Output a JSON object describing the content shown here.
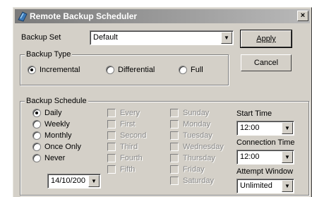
{
  "window": {
    "title": "Remote Backup Scheduler",
    "close_label": "×"
  },
  "backup_set": {
    "label": "Backup Set",
    "value": "Default"
  },
  "buttons": {
    "apply": "Apply",
    "cancel": "Cancel"
  },
  "backup_type": {
    "legend": "Backup Type",
    "options": [
      {
        "label": "Incremental",
        "selected": true
      },
      {
        "label": "Differential",
        "selected": false
      },
      {
        "label": "Full",
        "selected": false
      }
    ]
  },
  "schedule": {
    "legend": "Backup Schedule",
    "frequency": [
      {
        "label": "Daily",
        "selected": true
      },
      {
        "label": "Weekly",
        "selected": false
      },
      {
        "label": "Monthly",
        "selected": false
      },
      {
        "label": "Once Only",
        "selected": false
      },
      {
        "label": "Never",
        "selected": false
      }
    ],
    "occurrence": [
      "Every",
      "First",
      "Second",
      "Third",
      "Fourth",
      "Fifth"
    ],
    "days": [
      "Sunday",
      "Monday",
      "Tuesday",
      "Wednesday",
      "Thursday",
      "Friday",
      "Saturday"
    ],
    "date_value": "14/10/200",
    "start_time_label": "Start Time",
    "start_time_value": "12:00",
    "connection_time_label": "Connection Time",
    "connection_time_value": "12:00",
    "attempt_window_label": "Attempt Window",
    "attempt_window_value": "Unlimited"
  },
  "icons": {
    "app": "backup-app-icon",
    "dropdown": "chevron-down-icon"
  }
}
